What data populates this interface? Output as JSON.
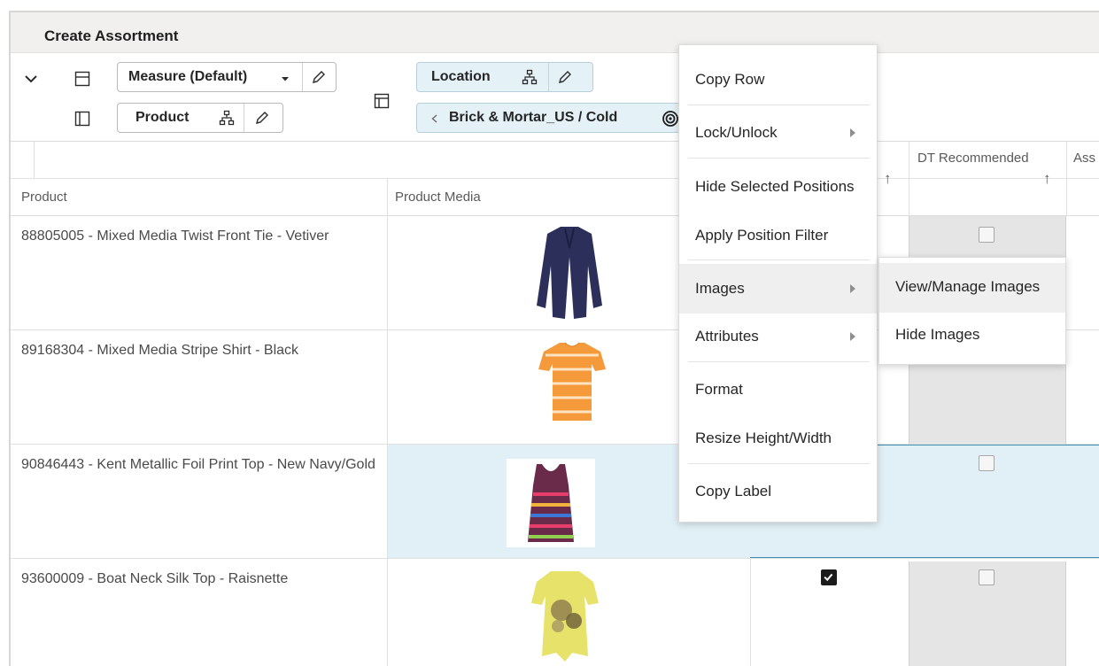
{
  "window": {
    "title": "Create Assortment"
  },
  "toolbar": {
    "measure_label": "Measure (Default)",
    "product_label": "Product",
    "location_label": "Location",
    "location_value": "Brick & Mortar_US / Cold"
  },
  "grid": {
    "columns": {
      "product": "Product",
      "product_media": "Product Media",
      "dt_recommended": "DT Recommended",
      "sort_arrow": "↑",
      "partial_next": "Ass"
    },
    "rows": [
      {
        "name": "88805005 - Mixed Media Twist Front Tie - Vetiver",
        "selected": false,
        "dt_recommended": false
      },
      {
        "name": "89168304 - Mixed Media Stripe Shirt - Black",
        "selected": false
      },
      {
        "name": "90846443 - Kent Metallic Foil Print Top - New Navy/Gold",
        "selected": true,
        "dt_recommended": false
      },
      {
        "name": "93600009 - Boat Neck Silk Top - Raisnette",
        "selected": false,
        "checked": true,
        "dt_recommended": false
      }
    ]
  },
  "context_menu": {
    "items": [
      {
        "label": "Copy Row"
      },
      {
        "label": "Lock/Unlock",
        "submenu": true
      },
      {
        "label": "Hide Selected Positions"
      },
      {
        "label": "Apply Position Filter"
      },
      {
        "label": "Images",
        "submenu": true,
        "highlighted": true
      },
      {
        "label": "Attributes",
        "submenu": true
      },
      {
        "label": "Format"
      },
      {
        "label": "Resize Height/Width"
      },
      {
        "label": "Copy Label"
      }
    ]
  },
  "images_submenu": {
    "items": [
      {
        "label": "View/Manage Images",
        "highlighted": true
      },
      {
        "label": "Hide Images"
      }
    ]
  },
  "colors": {
    "selection_bg": "#e1f0f6",
    "selection_border": "#3d8fb0",
    "menu_highlight": "#efefef",
    "header_bg": "#f1f0ee",
    "gray_column": "#e5e5e5"
  }
}
